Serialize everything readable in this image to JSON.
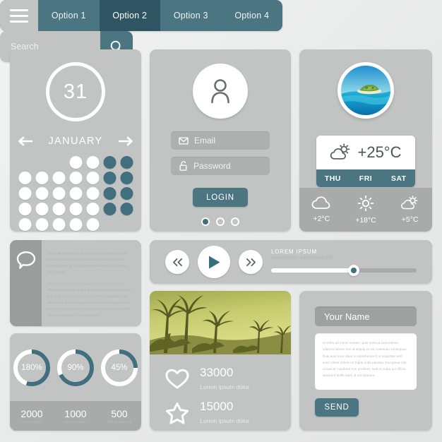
{
  "nav": {
    "menu_icon": "hamburger-icon",
    "tabs": [
      {
        "label": "Option 1",
        "active": false
      },
      {
        "label": "Option 2",
        "active": true
      },
      {
        "label": "Option 3",
        "active": false
      },
      {
        "label": "Option 4",
        "active": false
      }
    ]
  },
  "search": {
    "placeholder": "Search_",
    "value": "Search_",
    "icon": "search-icon"
  },
  "calendar": {
    "day": "31",
    "month": "JANUARY",
    "prev_icon": "arrow-left-icon",
    "next_icon": "arrow-right-icon",
    "grid": [
      [
        "e",
        "e",
        "e",
        "w",
        "w",
        "t",
        "t"
      ],
      [
        "w",
        "w",
        "w",
        "w",
        "w",
        "t",
        "t"
      ],
      [
        "w",
        "w",
        "w",
        "w",
        "w",
        "t",
        "t"
      ],
      [
        "w",
        "w",
        "w",
        "w",
        "w",
        "t",
        "t"
      ],
      [
        "w",
        "w",
        "w",
        "w",
        "w",
        "e",
        "e"
      ]
    ]
  },
  "login": {
    "avatar_icon": "user-icon",
    "email": {
      "label": "Email",
      "icon": "envelope-icon"
    },
    "password": {
      "label": "Password",
      "icon": "lock-icon"
    },
    "button_label": "LOGIN",
    "pager": [
      true,
      false,
      false
    ]
  },
  "weather": {
    "photo_alt": "tropical-island-photo",
    "current": {
      "icon": "sun-behind-cloud-icon",
      "temp": "+25°C"
    },
    "days": [
      "THU",
      "FRI",
      "SAT"
    ],
    "forecast": [
      {
        "icon": "cloud-icon",
        "temp": "+2°C"
      },
      {
        "icon": "sun-icon",
        "temp": "+18°C"
      },
      {
        "icon": "sun-behind-cloud-icon",
        "temp": "+5°C"
      }
    ]
  },
  "quote": {
    "icon": "speech-bubble-icon",
    "paragraph1": "Lorem ipsum dolor sit amet, consectetur adipiscing elit, sed do eiusmod tempor incididunt ut labore et dolore magna aliqua. Ut enim ad minim veniam, quis nostrud exercitation.",
    "paragraph2": "Ut enim ad minim veniam, quis nostrud exercitation ullamco laboris nisi ut aliquip ex ea commodo consequat. Duis aute irure dolor in reprehenderit in voluptate velit esse cillum dolore eu fugiat nulla pariatur. Excepteur sint occaecat cupidatat non proident, sunt in culpa qui officia deserunt mollit anim id est laborum."
  },
  "stats": {
    "donuts": [
      {
        "label": "180%",
        "percent": 55
      },
      {
        "label": "90%",
        "percent": 68
      },
      {
        "label": "45%",
        "percent": 25
      }
    ],
    "numbers": [
      {
        "value": "2000",
        "caption": "Lorem Ipsum"
      },
      {
        "value": "1000",
        "caption": "Dolor sit amet"
      },
      {
        "value": "500",
        "caption": "Sed do eiusmod"
      }
    ]
  },
  "player": {
    "prev_icon": "rewind-icon",
    "play_icon": "play-icon",
    "next_icon": "fast-forward-icon",
    "title": "LOREM IPSUM",
    "subtitle": "consectetur adipisicing elit",
    "progress_percent": 57
  },
  "photo_card": {
    "image_alt": "palm-trees-silhouette-photo",
    "stats": [
      {
        "icon": "heart-icon",
        "value": "33000",
        "caption": "Lorem ipsum dolor"
      },
      {
        "icon": "star-icon",
        "value": "15000",
        "caption": "Lorem ipsum dolor"
      }
    ]
  },
  "contact": {
    "name_value": "Your Name",
    "name_placeholder": "Your Name",
    "message_text": "Ut enim ad minim veniam, quis nostrud exercitation ullamco laboris nisi ut aliquip ex ea commodo consequat. Duis aute irure dolor in reprehenderit in voluptate velit esse cillum dolore eu fugiat nulla pariatur. Excepteur sint occaecat cupidatat non proident, sunt in culpa qui officia deserunt mollit anim id est laborum.",
    "send_label": "SEND"
  },
  "colors": {
    "teal": "#4c7582",
    "teal_dark": "#2f5562",
    "teal_accent": "#416f7e",
    "panel_gray": "#c2c3c3",
    "footer_gray": "#a9aaaa",
    "background": "#eceded"
  }
}
